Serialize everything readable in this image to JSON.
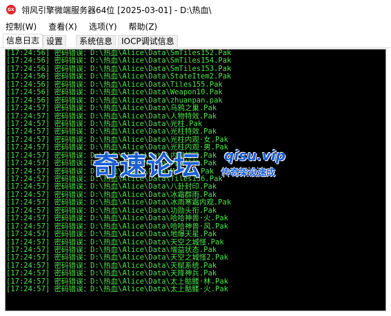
{
  "window": {
    "icon_text": "GX",
    "title": "翎风引擎微端服务器64位 [2025-03-01] - D:\\热血\\"
  },
  "menu": [
    {
      "label": "控制(W)"
    },
    {
      "label": "查看(X)"
    },
    {
      "label": "选项(Y)"
    },
    {
      "label": "帮助(Z)"
    }
  ],
  "tabs": [
    {
      "label": "信息日志",
      "active": true
    },
    {
      "label": "设置",
      "active": false
    },
    {
      "label": "系统信息",
      "active": false
    },
    {
      "label": "IOCP调试信息",
      "active": false
    }
  ],
  "colors": {
    "log_text": "#4ee84e",
    "console_bg": "#000000",
    "watermark": "#1a5fd6"
  },
  "log": [
    "[17:24:56] 密码错误：D:\\热血\\Alice\\Data\\SmTiles152.Pak",
    "[17:24:56] 密码错误：D:\\热血\\Alice\\Data\\SmTiles154.Pak",
    "[17:24:56] 密码错误：D:\\热血\\Alice\\Data\\SmTiles153.Pak",
    "[17:24:56] 密码错误：D:\\热血\\Alice\\Data\\StateItem2.Pak",
    "[17:24:56] 密码错误：D:\\热血\\Alice\\Data\\Tiles155.Pak",
    "[17:24:56] 密码错误：D:\\热血\\Alice\\Data\\Weapon10.Pak",
    "[17:24:56] 密码错误：D:\\热血\\Alice\\Data\\zhuanpan.pak",
    "[17:24:57] 密码错误：D:\\热血\\Alice\\Data\\乌鸦之巢.Pak",
    "[17:24:57] 密码错误：D:\\热血\\Alice\\Data\\人物特效.Pak",
    "[17:24:57] 密码错误：D:\\热血\\Alice\\Data\\光柱.Pak",
    "[17:24:57] 密码错误：D:\\热血\\Alice\\Data\\光柱特效.Pak",
    "[17:24:57] 密码错误：D:\\热血\\Alice\\Data\\光柱内观·女.Pak",
    "[17:24:57] 密码错误：D:\\热血\\Alice\\Data\\光柱内观·男.Pak",
    "[17:24:57] 密码错误：D:\\热血\\Alice\\Data\\内观翅膀.Pak",
    "[17:24:57] 密码错误：D:\\热血\\Alice\\Data\\内观特效.Pak",
    "[17:24:57] 密码错误：D:\\热血\\Alice\\Data\\Mon154.Pak",
    "[17:24:57] 密码错误：D:\\热血\\Alice\\Data\\Tiles156.Pak",
    "[17:24:57] 密码错误：D:\\热血\\Alice\\Data\\八卦封印.Pak",
    "[17:24:57] 密码错误：D:\\热血\\Alice\\Data\\冰霜群雨.Pak",
    "[17:24:57] 密码错误：D:\\热血\\Alice\\Data\\冰雨寒霜内观.Pak",
    "[17:24:57] 密码错误：D:\\热血\\Alice\\Data\\功勋头衔.Pak",
    "[17:24:57] 密码错误：D:\\热血\\Alice\\Data\\哈哈神兽·火.Pak",
    "[17:24:57] 密码错误：D:\\热血\\Alice\\Data\\哈哈神兽·风.Pak",
    "[17:24:57] 密码错误：D:\\热血\\Alice\\Data\\地爆天星.Pak",
    "[17:24:57] 密码错误：D:\\热血\\Alice\\Data\\天空之城怪.Pak",
    "[17:24:57] 密码错误：D:\\热血\\Alice\\Data\\增益状态.Pak",
    "[17:24:57] 密码错误：D:\\热血\\Alice\\Data\\天空之城怪2.Pak",
    "[17:24:57] 密码错误：D:\\热血\\Alice\\Data\\天赋系统.Pak",
    "[17:24:57] 密码错误：D:\\热血\\Alice\\Data\\天降神兵.Pak",
    "[17:24:57] 密码错误：D:\\热血\\Alice\\Data\\太上骷髅·林.Pak",
    "[17:24:57] 密码错误：D:\\热血\\Alice\\Data\\太上骷髅·火.Pak"
  ],
  "watermark": {
    "main": "奇速论坛",
    "domain": "qisu.vip",
    "sub": "传奇架设速成"
  }
}
